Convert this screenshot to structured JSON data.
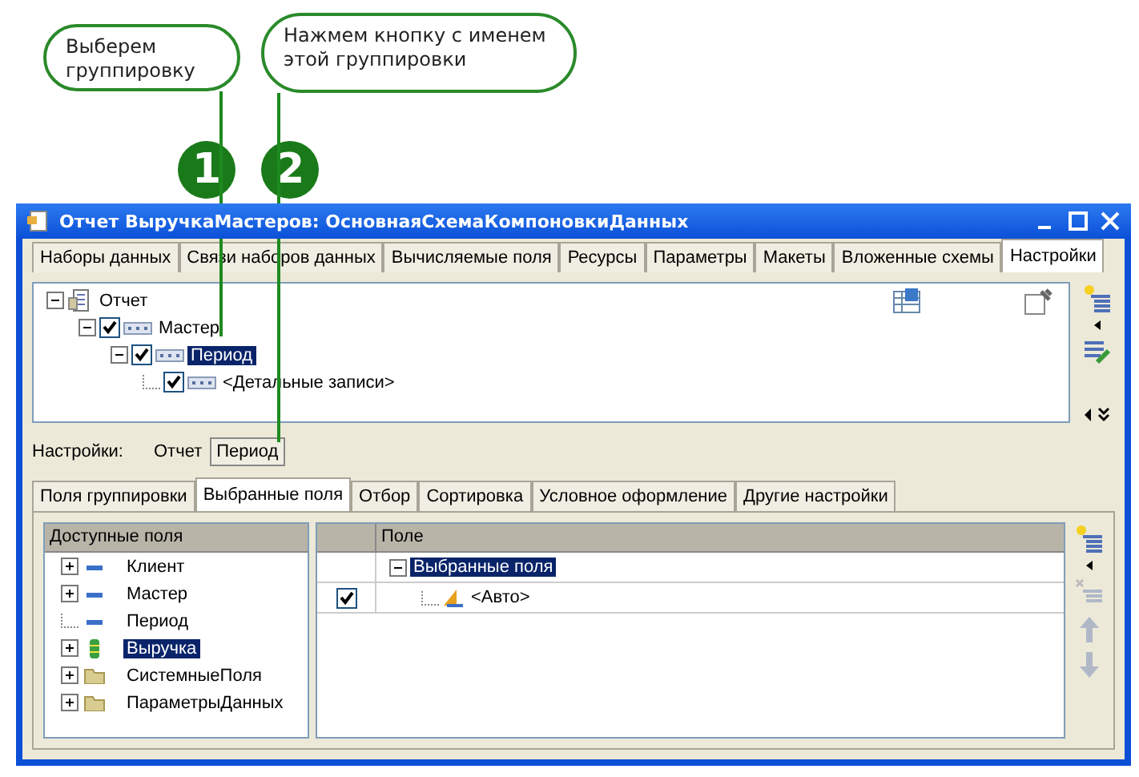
{
  "callouts": [
    {
      "text": "Выберем группировку"
    },
    {
      "text": "Нажмем кнопку с именем этой группировки"
    }
  ],
  "markers": [
    "1",
    "2"
  ],
  "window": {
    "title": "Отчет ВыручкаМастеров: ОсновнаяСхемаКомпоновкиДанных",
    "tabs": [
      {
        "label": "Наборы данных",
        "selected": false
      },
      {
        "label": "Связи наборов данных",
        "selected": false
      },
      {
        "label": "Вычисляемые поля",
        "selected": false
      },
      {
        "label": "Ресурсы",
        "selected": false
      },
      {
        "label": "Параметры",
        "selected": false
      },
      {
        "label": "Макеты",
        "selected": false
      },
      {
        "label": "Вложенные схемы",
        "selected": false
      },
      {
        "label": "Настройки",
        "selected": true
      }
    ],
    "structure": [
      {
        "kind": "report",
        "label": "Отчет",
        "expanded": true,
        "selected": false,
        "children": [
          {
            "kind": "group",
            "label": "Мастер",
            "checked": true,
            "expanded": true,
            "selected": false,
            "children": [
              {
                "kind": "group",
                "label": "Период",
                "checked": true,
                "expanded": true,
                "selected": true,
                "children": [
                  {
                    "kind": "group",
                    "label": "<Детальные записи>",
                    "checked": true,
                    "selected": false
                  }
                ]
              }
            ]
          }
        ]
      }
    ],
    "settings_label": "Настройки:",
    "settings_buttons": [
      {
        "label": "Отчет",
        "selected": false
      },
      {
        "label": "Период",
        "selected": true
      }
    ],
    "subtabs": [
      {
        "label": "Поля группировки",
        "selected": false
      },
      {
        "label": "Выбранные поля",
        "selected": true
      },
      {
        "label": "Отбор",
        "selected": false
      },
      {
        "label": "Сортировка",
        "selected": false
      },
      {
        "label": "Условное оформление",
        "selected": false
      },
      {
        "label": "Другие настройки",
        "selected": false
      }
    ],
    "available_fields": {
      "header": "Доступные поля",
      "items": [
        {
          "kind": "field",
          "label": "Клиент",
          "expandable": true,
          "selected": false
        },
        {
          "kind": "field",
          "label": "Мастер",
          "expandable": true,
          "selected": false
        },
        {
          "kind": "field",
          "label": "Период",
          "expandable": false,
          "selected": false
        },
        {
          "kind": "resource",
          "label": "Выручка",
          "expandable": true,
          "selected": true
        },
        {
          "kind": "folder",
          "label": "СистемныеПоля",
          "expandable": true,
          "selected": false
        },
        {
          "kind": "folder",
          "label": "ПараметрыДанных",
          "expandable": true,
          "selected": false
        }
      ]
    },
    "selected_fields": {
      "header": "Поле",
      "rows": [
        {
          "kind": "group",
          "label": "Выбранные поля",
          "selected": true,
          "expanded": true
        },
        {
          "kind": "auto",
          "label": "<Авто>",
          "checked": true,
          "selected": false
        }
      ]
    }
  }
}
